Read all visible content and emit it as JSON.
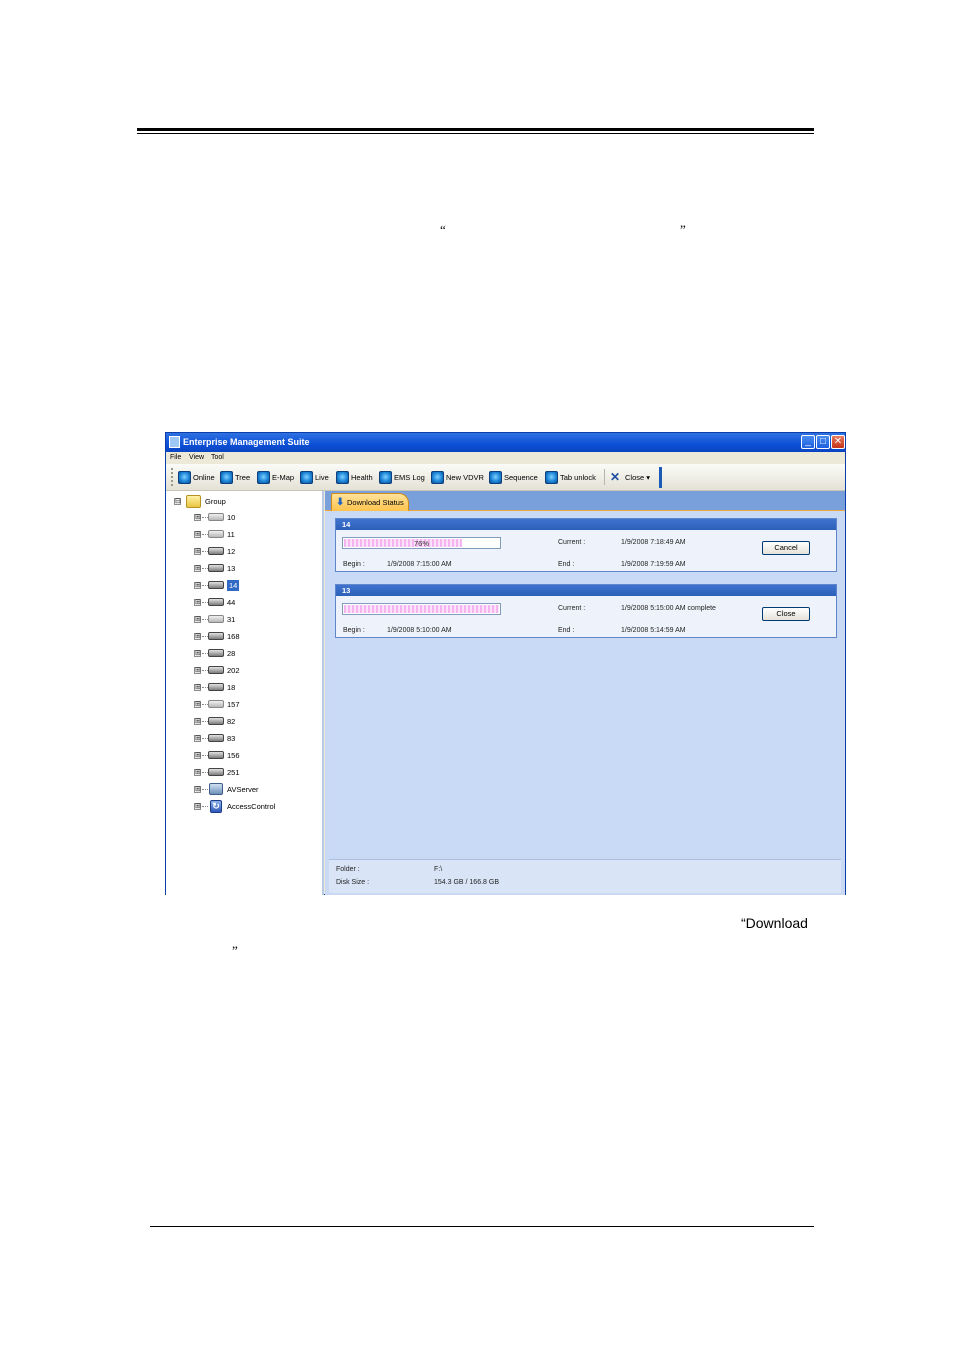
{
  "doc": {
    "open_quote": "“",
    "close_quote": "”",
    "caption_open": "“Download",
    "caption_close": "”"
  },
  "window": {
    "title": "Enterprise Management Suite",
    "controls": {
      "minimize": "_",
      "maximize": "□",
      "close": "✕"
    }
  },
  "menu": [
    "File",
    "View",
    "Tool"
  ],
  "toolbar": {
    "buttons": [
      {
        "label": "Online",
        "icon": "online-icon"
      },
      {
        "label": "Tree",
        "icon": "tree-icon"
      },
      {
        "label": "E-Map",
        "icon": "emap-icon"
      },
      {
        "label": "Live",
        "icon": "live-icon"
      },
      {
        "label": "Health",
        "icon": "health-icon"
      },
      {
        "label": "EMS Log",
        "icon": "log-icon"
      },
      {
        "label": "New VDVR",
        "icon": "vdvr-icon"
      },
      {
        "label": "Sequence",
        "icon": "sequence-icon"
      },
      {
        "label": "Tab unlock",
        "icon": "unlock-icon"
      },
      {
        "label": "Close ▾",
        "icon": "close-icon"
      }
    ]
  },
  "tree": {
    "root": "Group",
    "expander_open": "⊟",
    "expander_closed": "⊞",
    "selected": "14",
    "nodes": [
      "10",
      "11",
      "12",
      "13",
      "14",
      "44",
      "31",
      "168",
      "28",
      "202",
      "18",
      "157",
      "82",
      "83",
      "156",
      "251",
      "AVServer",
      "AccessControl"
    ]
  },
  "tab": {
    "label": "Download Status",
    "icon": "download-arrow-icon"
  },
  "jobs": [
    {
      "name": "14",
      "progress_text": "76%",
      "progress": 0.76,
      "current_label": "Current :",
      "current_value": "1/9/2008 7:18:49 AM",
      "begin_label": "Begin :",
      "begin_value": "1/9/2008 7:15:00 AM",
      "end_label": "End :",
      "end_value": "1/9/2008 7:19:59 AM",
      "button": "Cancel"
    },
    {
      "name": "13",
      "progress_text": "",
      "progress": 1.0,
      "current_label": "Current :",
      "current_value": "1/9/2008 5:15:00 AM complete",
      "begin_label": "Begin :",
      "begin_value": "1/9/2008 5:10:00 AM",
      "end_label": "End :",
      "end_value": "1/9/2008 5:14:59 AM",
      "button": "Close"
    }
  ],
  "footer": {
    "folder_label": "Folder :",
    "folder_value": "F:\\",
    "disk_label": "Disk Size :",
    "disk_value": "154.3 GB / 166.8 GB"
  },
  "colors": {
    "titlebar": "#0b4fd6",
    "tab_active": "#ffc34d",
    "job_header": "#2c5fb8",
    "progress_fill": "#f3b4f0",
    "content_bg": "#c8daf6"
  }
}
